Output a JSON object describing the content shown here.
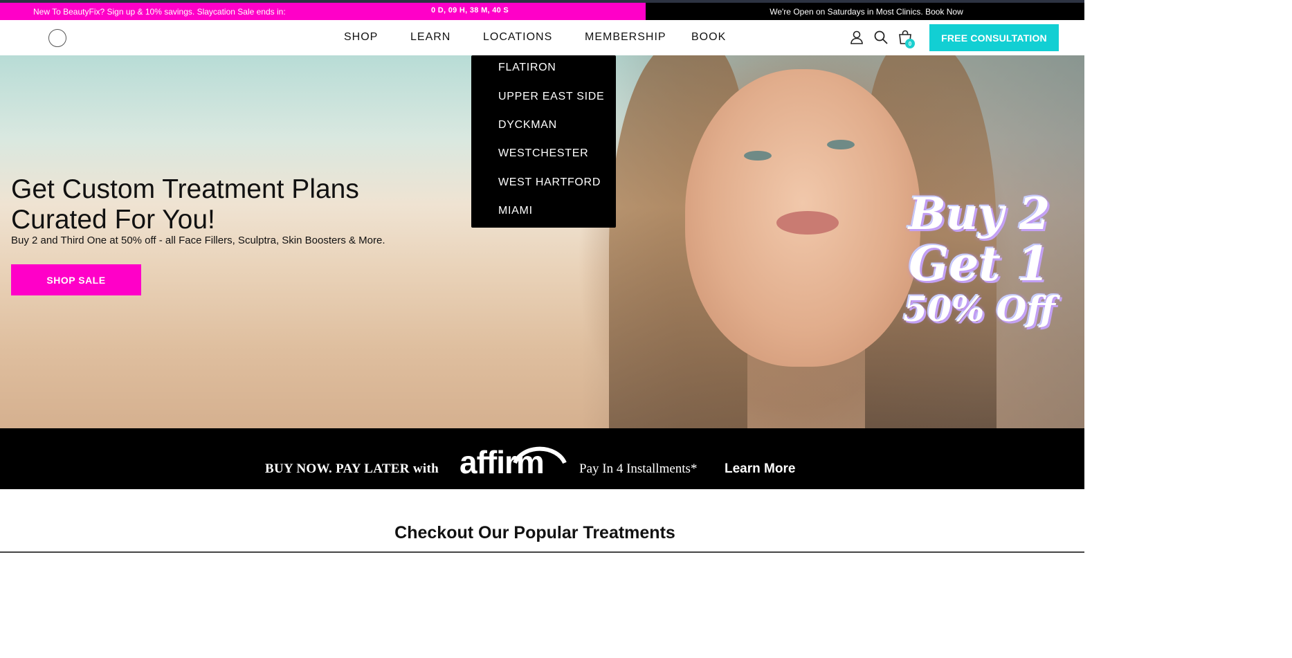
{
  "announcement": {
    "promo_text": "New To BeautyFix? Sign up & 10% savings. Slaycation Sale ends in:",
    "countdown": "0 D, 09 H, 38 M, 40 S",
    "right_text": "We're Open on Saturdays in Most Clinics. Book Now",
    "promo_bg": "#ff00c8",
    "right_bg": "#000000"
  },
  "header": {
    "logo_icon": "circle-logo-icon",
    "nav": [
      "SHOP",
      "LEARN",
      "LOCATIONS",
      "MEMBERSHIP",
      "BOOK"
    ],
    "icons": [
      "user-icon",
      "search-icon",
      "shopping-bag-icon"
    ],
    "cart_count": "0",
    "cta": "FREE CONSULTATION",
    "cta_color": "#12cfd3"
  },
  "locations_dropdown": {
    "items": [
      "FLATIRON",
      "UPPER EAST SIDE",
      "DYCKMAN",
      "WESTCHESTER",
      "WEST HARTFORD",
      "MIAMI"
    ]
  },
  "hero": {
    "title_line1": "Get Custom Treatment Plans",
    "title_line2": "Curated For You!",
    "subtitle": "Buy 2 and Third One at 50% off - all Face Fillers, Sculptra, Skin Boosters & More.",
    "button": "SHOP SALE",
    "badge_line1": "Buy 2",
    "badge_line2": "Get 1",
    "badge_line3": "50% Off"
  },
  "affirm": {
    "lead": "BUY NOW. PAY LATER with",
    "logo_text": "affirm",
    "installments": "Pay In 4 Installments*",
    "learn_more": "Learn More"
  },
  "popular": {
    "title": "Checkout Our Popular Treatments"
  }
}
